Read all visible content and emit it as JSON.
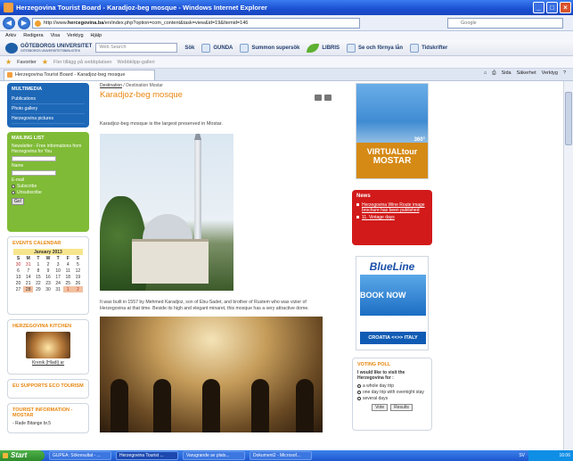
{
  "window": {
    "title": "Herzegovina Tourist Board - Karadjoz-beg mosque - Windows Internet Explorer"
  },
  "address": {
    "url_prefix": "http://www.",
    "url_host": "hercegovina.ba",
    "url_rest": "/en/index.php?option=com_content&task=view&id=19&Itemid=146",
    "search_placeholder": "Google"
  },
  "menu": [
    "Arkiv",
    "Redigera",
    "Visa",
    "Verktyg",
    "Hjälp"
  ],
  "toolbar": {
    "gu_line1": "GÖTEBORGS UNIVERSITET",
    "gu_line2": "GÖTEBORGS UNIVERSITETSBIBLIOTEK",
    "search_placeholder": "Web Search",
    "sok": "Sök",
    "gunda": "GUNDA",
    "summon": "Summon supersök",
    "libris": "LIBRIS",
    "fornya": "Se och förnya lån",
    "tidskrifter": "Tidskrifter"
  },
  "favorites": {
    "label": "Favoriter",
    "item1": "Fler tillägg på webbplatsen",
    "item2": "Webbklipp-galleri"
  },
  "tab": {
    "label": "Herzegovina Tourist Board - Karadjoz-beg mosque"
  },
  "commands": {
    "sida": "Sida",
    "sakerhet": "Säkerhet",
    "verktyg": "Verktyg"
  },
  "left": {
    "multimedia": {
      "title": "MULTIMEDIA",
      "items": [
        "Publications",
        "Photo gallery",
        "Herzegovina pictures"
      ]
    },
    "mailing": {
      "title": "MAILING LIST",
      "desc": "Newsletter - Free informations from Herzegovina for You",
      "name": "Name",
      "email": "E-mail",
      "subscribe": "Subscribe",
      "unsubscribe": "Unsubscribe",
      "go": "Go!"
    },
    "events": {
      "title": "EVENTS CALENDAR",
      "month": "January 2013",
      "dow": [
        "S",
        "M",
        "T",
        "W",
        "T",
        "F",
        "S"
      ],
      "weeks": [
        [
          "30",
          "31",
          "1",
          "2",
          "3",
          "4",
          "5"
        ],
        [
          "6",
          "7",
          "8",
          "9",
          "10",
          "11",
          "12"
        ],
        [
          "13",
          "14",
          "15",
          "16",
          "17",
          "18",
          "19"
        ],
        [
          "20",
          "21",
          "22",
          "23",
          "24",
          "25",
          "26"
        ],
        [
          "27",
          "28",
          "29",
          "30",
          "31",
          "1",
          "2"
        ]
      ]
    },
    "kitchen": {
      "title": "HERZEGOVINA KITCHEN",
      "caption": "Krenik (Hladi) ar"
    },
    "eu": {
      "title": "EU SUPPORTS ECO TOURISM"
    },
    "info": {
      "title": "TOURIST INFORMATION - MOSTAR",
      "addr": "- Rade Bitange br.5"
    }
  },
  "content": {
    "crumb1": "Destination",
    "crumb_sep": "/",
    "crumb2": "Destination Mostar",
    "title": "Karadjoz-beg mosque",
    "lead": "Karadjoz-beg mosque is the largest preserved in Mostar.",
    "body": "It was built in 1557 by Mehmed Karadjoz, son of Ebu-Sadet, and brother of Rustem who was vizier of Herzegovina at that time. Beside its high and elegant minaret, this mosque has a very attractive dome."
  },
  "right": {
    "ad1": {
      "line1": "VIRTUALtour",
      "line2": "MOSTAR",
      "deg": "360°"
    },
    "news": {
      "title": "News",
      "items": [
        "Herzegovina Wine Route image brochure has been published",
        "11. Vintage days"
      ]
    },
    "ad2": {
      "brand": "BlueLine",
      "cta": "BOOK NOW",
      "route": "CROATIA <<>> ITALY"
    },
    "poll": {
      "title": "VOTING POLL",
      "question": "I would like to visit the Herzegovina for :",
      "options": [
        "a whole day trip",
        "one day trip with overnight stay",
        "several days"
      ],
      "vote": "Vote",
      "results": "Results"
    }
  },
  "taskbar": {
    "start": "Start",
    "tasks": [
      "GUPEA: Sökresultat - ...",
      "Herzegovina Tourist ...",
      "Varugrande av plats...",
      "Dokument2 - Microsof..."
    ],
    "lang": "SV",
    "clock": "16:06"
  }
}
